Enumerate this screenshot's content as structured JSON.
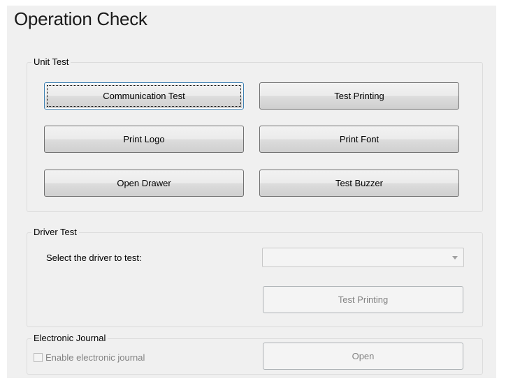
{
  "page": {
    "title": "Operation Check"
  },
  "unit_test": {
    "label": "Unit Test",
    "buttons": {
      "communication_test": "Communication Test",
      "test_printing": "Test Printing",
      "print_logo": "Print Logo",
      "print_font": "Print Font",
      "open_drawer": "Open Drawer",
      "test_buzzer": "Test Buzzer"
    }
  },
  "driver_test": {
    "label": "Driver Test",
    "select_label": "Select the driver to test:",
    "select_value": "",
    "select_enabled": false,
    "test_printing_label": "Test Printing",
    "test_printing_enabled": false
  },
  "electronic_journal": {
    "label": "Electronic Journal",
    "checkbox_label": "Enable electronic journal",
    "checkbox_checked": false,
    "checkbox_enabled": false,
    "open_label": "Open",
    "open_enabled": false
  },
  "colors": {
    "panel_background": "#f0f0f0",
    "disabled_text": "#838383",
    "focus_border": "#3c7fb1"
  },
  "icons": {
    "combo_dropdown": "chevron-down-icon"
  }
}
